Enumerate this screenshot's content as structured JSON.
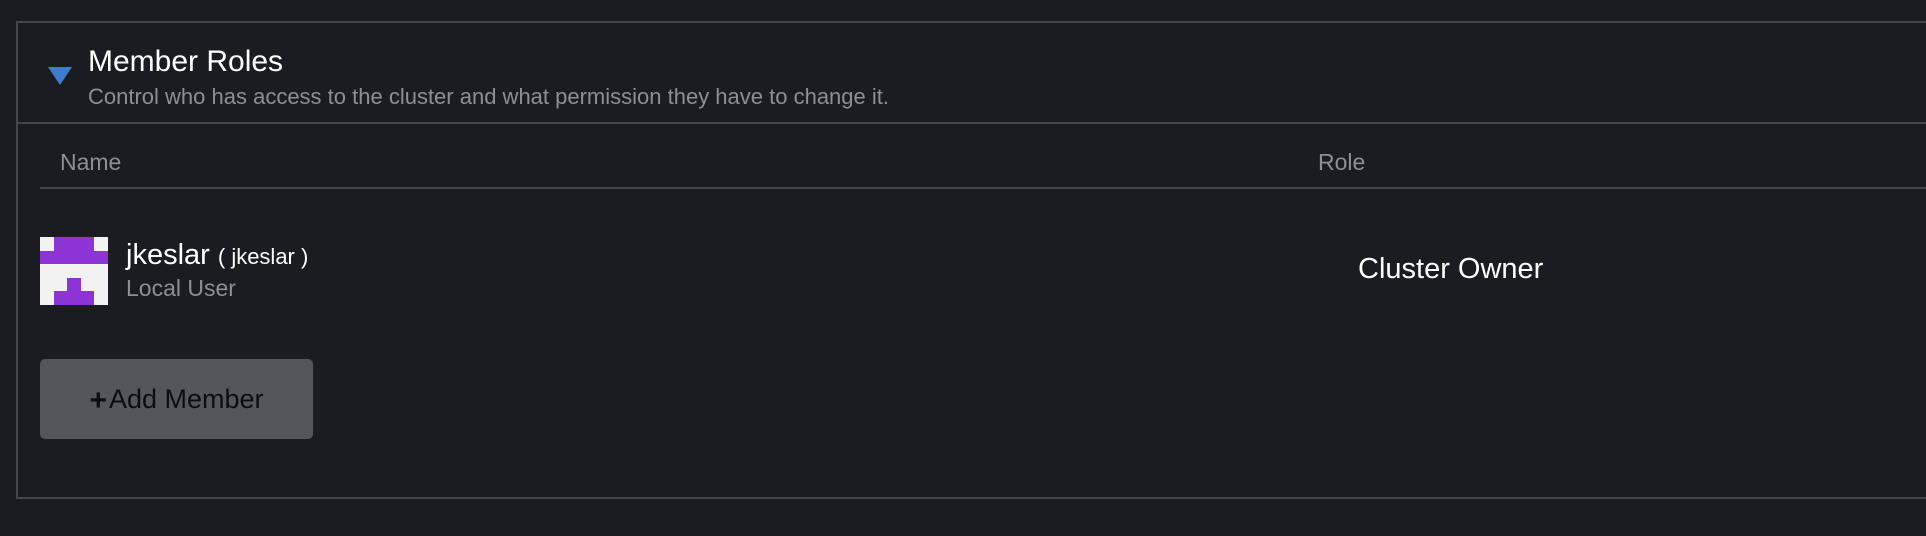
{
  "section": {
    "title": "Member Roles",
    "subtitle": "Control who has access to the cluster and what permission they have to change it."
  },
  "table": {
    "columns": [
      "Name",
      "Role"
    ],
    "rows": [
      {
        "display_name": "jkeslar",
        "username": "( jkeslar )",
        "user_type": "Local User",
        "role": "Cluster Owner",
        "avatar_icon": "identicon-avatar"
      }
    ]
  },
  "actions": {
    "add_member_label": "Add Member",
    "add_member_icon": "plus-icon"
  },
  "colors": {
    "background": "#1b1c21",
    "border": "#44464d",
    "accent": "#3e7ccf",
    "avatar_purple": "#8d34d6",
    "button_bg": "#55565b",
    "muted_text": "#8d8f96"
  }
}
